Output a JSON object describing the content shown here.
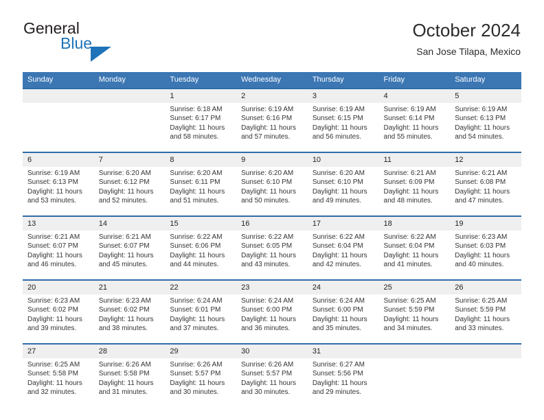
{
  "brand": {
    "word_one": "General",
    "word_two": "Blue",
    "triangle_color": "#1f73b8"
  },
  "header": {
    "title": "October 2024",
    "subtitle": "San Jose Tilapa, Mexico"
  },
  "theme": {
    "header_blue": "#3c77b4",
    "separator_blue": "#2e6ca8",
    "daynum_band": "#efefef",
    "text": "#333333"
  },
  "calendar": {
    "weekday_headers": [
      "Sunday",
      "Monday",
      "Tuesday",
      "Wednesday",
      "Thursday",
      "Friday",
      "Saturday"
    ],
    "weeks": [
      [
        {
          "day": "",
          "sunrise": "",
          "sunset": "",
          "daylight_1": "",
          "daylight_2": ""
        },
        {
          "day": "",
          "sunrise": "",
          "sunset": "",
          "daylight_1": "",
          "daylight_2": ""
        },
        {
          "day": "1",
          "sunrise": "Sunrise: 6:18 AM",
          "sunset": "Sunset: 6:17 PM",
          "daylight_1": "Daylight: 11 hours",
          "daylight_2": "and 58 minutes."
        },
        {
          "day": "2",
          "sunrise": "Sunrise: 6:19 AM",
          "sunset": "Sunset: 6:16 PM",
          "daylight_1": "Daylight: 11 hours",
          "daylight_2": "and 57 minutes."
        },
        {
          "day": "3",
          "sunrise": "Sunrise: 6:19 AM",
          "sunset": "Sunset: 6:15 PM",
          "daylight_1": "Daylight: 11 hours",
          "daylight_2": "and 56 minutes."
        },
        {
          "day": "4",
          "sunrise": "Sunrise: 6:19 AM",
          "sunset": "Sunset: 6:14 PM",
          "daylight_1": "Daylight: 11 hours",
          "daylight_2": "and 55 minutes."
        },
        {
          "day": "5",
          "sunrise": "Sunrise: 6:19 AM",
          "sunset": "Sunset: 6:13 PM",
          "daylight_1": "Daylight: 11 hours",
          "daylight_2": "and 54 minutes."
        }
      ],
      [
        {
          "day": "6",
          "sunrise": "Sunrise: 6:19 AM",
          "sunset": "Sunset: 6:13 PM",
          "daylight_1": "Daylight: 11 hours",
          "daylight_2": "and 53 minutes."
        },
        {
          "day": "7",
          "sunrise": "Sunrise: 6:20 AM",
          "sunset": "Sunset: 6:12 PM",
          "daylight_1": "Daylight: 11 hours",
          "daylight_2": "and 52 minutes."
        },
        {
          "day": "8",
          "sunrise": "Sunrise: 6:20 AM",
          "sunset": "Sunset: 6:11 PM",
          "daylight_1": "Daylight: 11 hours",
          "daylight_2": "and 51 minutes."
        },
        {
          "day": "9",
          "sunrise": "Sunrise: 6:20 AM",
          "sunset": "Sunset: 6:10 PM",
          "daylight_1": "Daylight: 11 hours",
          "daylight_2": "and 50 minutes."
        },
        {
          "day": "10",
          "sunrise": "Sunrise: 6:20 AM",
          "sunset": "Sunset: 6:10 PM",
          "daylight_1": "Daylight: 11 hours",
          "daylight_2": "and 49 minutes."
        },
        {
          "day": "11",
          "sunrise": "Sunrise: 6:21 AM",
          "sunset": "Sunset: 6:09 PM",
          "daylight_1": "Daylight: 11 hours",
          "daylight_2": "and 48 minutes."
        },
        {
          "day": "12",
          "sunrise": "Sunrise: 6:21 AM",
          "sunset": "Sunset: 6:08 PM",
          "daylight_1": "Daylight: 11 hours",
          "daylight_2": "and 47 minutes."
        }
      ],
      [
        {
          "day": "13",
          "sunrise": "Sunrise: 6:21 AM",
          "sunset": "Sunset: 6:07 PM",
          "daylight_1": "Daylight: 11 hours",
          "daylight_2": "and 46 minutes."
        },
        {
          "day": "14",
          "sunrise": "Sunrise: 6:21 AM",
          "sunset": "Sunset: 6:07 PM",
          "daylight_1": "Daylight: 11 hours",
          "daylight_2": "and 45 minutes."
        },
        {
          "day": "15",
          "sunrise": "Sunrise: 6:22 AM",
          "sunset": "Sunset: 6:06 PM",
          "daylight_1": "Daylight: 11 hours",
          "daylight_2": "and 44 minutes."
        },
        {
          "day": "16",
          "sunrise": "Sunrise: 6:22 AM",
          "sunset": "Sunset: 6:05 PM",
          "daylight_1": "Daylight: 11 hours",
          "daylight_2": "and 43 minutes."
        },
        {
          "day": "17",
          "sunrise": "Sunrise: 6:22 AM",
          "sunset": "Sunset: 6:04 PM",
          "daylight_1": "Daylight: 11 hours",
          "daylight_2": "and 42 minutes."
        },
        {
          "day": "18",
          "sunrise": "Sunrise: 6:22 AM",
          "sunset": "Sunset: 6:04 PM",
          "daylight_1": "Daylight: 11 hours",
          "daylight_2": "and 41 minutes."
        },
        {
          "day": "19",
          "sunrise": "Sunrise: 6:23 AM",
          "sunset": "Sunset: 6:03 PM",
          "daylight_1": "Daylight: 11 hours",
          "daylight_2": "and 40 minutes."
        }
      ],
      [
        {
          "day": "20",
          "sunrise": "Sunrise: 6:23 AM",
          "sunset": "Sunset: 6:02 PM",
          "daylight_1": "Daylight: 11 hours",
          "daylight_2": "and 39 minutes."
        },
        {
          "day": "21",
          "sunrise": "Sunrise: 6:23 AM",
          "sunset": "Sunset: 6:02 PM",
          "daylight_1": "Daylight: 11 hours",
          "daylight_2": "and 38 minutes."
        },
        {
          "day": "22",
          "sunrise": "Sunrise: 6:24 AM",
          "sunset": "Sunset: 6:01 PM",
          "daylight_1": "Daylight: 11 hours",
          "daylight_2": "and 37 minutes."
        },
        {
          "day": "23",
          "sunrise": "Sunrise: 6:24 AM",
          "sunset": "Sunset: 6:00 PM",
          "daylight_1": "Daylight: 11 hours",
          "daylight_2": "and 36 minutes."
        },
        {
          "day": "24",
          "sunrise": "Sunrise: 6:24 AM",
          "sunset": "Sunset: 6:00 PM",
          "daylight_1": "Daylight: 11 hours",
          "daylight_2": "and 35 minutes."
        },
        {
          "day": "25",
          "sunrise": "Sunrise: 6:25 AM",
          "sunset": "Sunset: 5:59 PM",
          "daylight_1": "Daylight: 11 hours",
          "daylight_2": "and 34 minutes."
        },
        {
          "day": "26",
          "sunrise": "Sunrise: 6:25 AM",
          "sunset": "Sunset: 5:59 PM",
          "daylight_1": "Daylight: 11 hours",
          "daylight_2": "and 33 minutes."
        }
      ],
      [
        {
          "day": "27",
          "sunrise": "Sunrise: 6:25 AM",
          "sunset": "Sunset: 5:58 PM",
          "daylight_1": "Daylight: 11 hours",
          "daylight_2": "and 32 minutes."
        },
        {
          "day": "28",
          "sunrise": "Sunrise: 6:26 AM",
          "sunset": "Sunset: 5:58 PM",
          "daylight_1": "Daylight: 11 hours",
          "daylight_2": "and 31 minutes."
        },
        {
          "day": "29",
          "sunrise": "Sunrise: 6:26 AM",
          "sunset": "Sunset: 5:57 PM",
          "daylight_1": "Daylight: 11 hours",
          "daylight_2": "and 30 minutes."
        },
        {
          "day": "30",
          "sunrise": "Sunrise: 6:26 AM",
          "sunset": "Sunset: 5:57 PM",
          "daylight_1": "Daylight: 11 hours",
          "daylight_2": "and 30 minutes."
        },
        {
          "day": "31",
          "sunrise": "Sunrise: 6:27 AM",
          "sunset": "Sunset: 5:56 PM",
          "daylight_1": "Daylight: 11 hours",
          "daylight_2": "and 29 minutes."
        },
        {
          "day": "",
          "sunrise": "",
          "sunset": "",
          "daylight_1": "",
          "daylight_2": ""
        },
        {
          "day": "",
          "sunrise": "",
          "sunset": "",
          "daylight_1": "",
          "daylight_2": ""
        }
      ]
    ]
  }
}
